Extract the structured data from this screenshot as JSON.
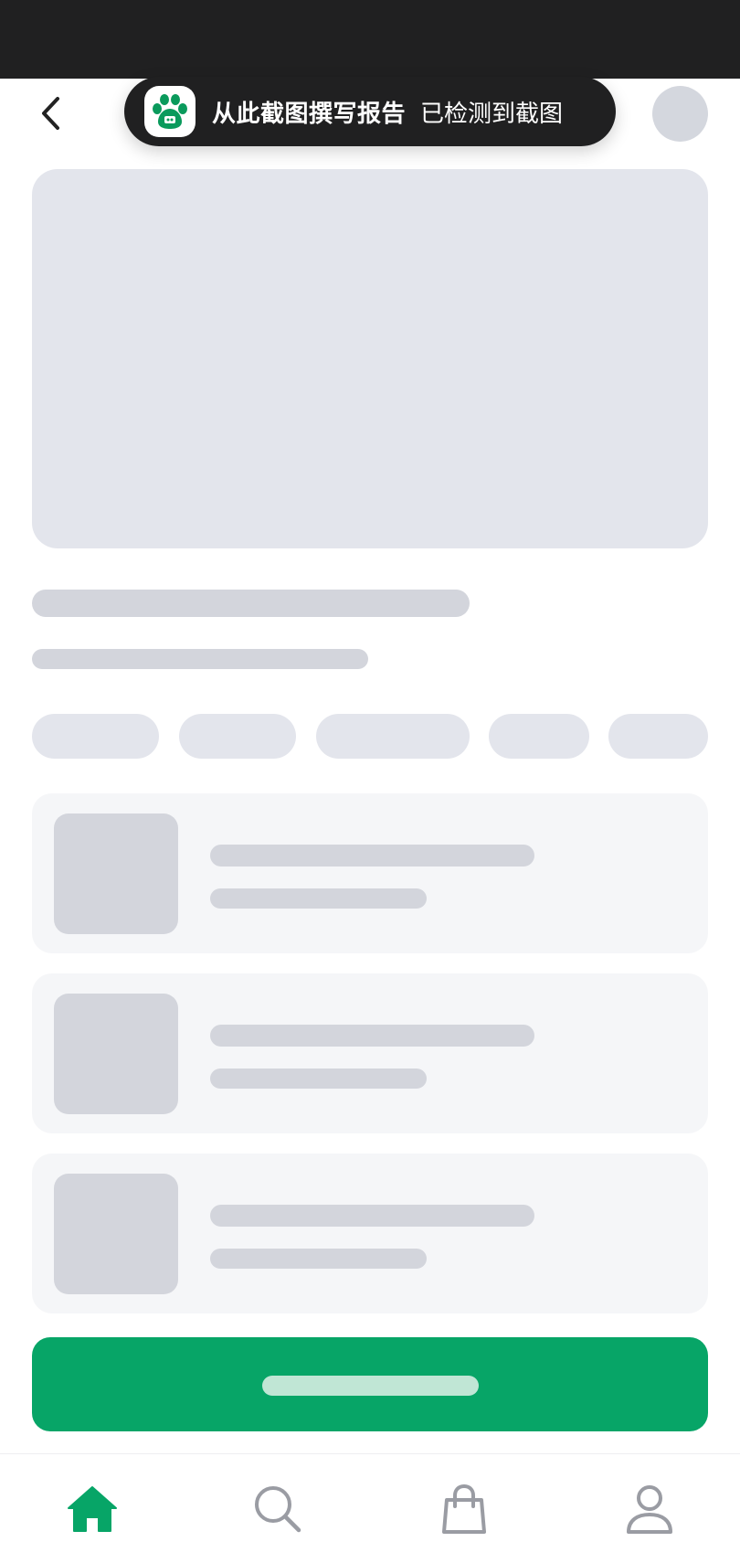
{
  "toast": {
    "title": "从此截图撰写报告",
    "subtitle": "已检测到截图",
    "icon": "paw-icon",
    "icon_color": "#0a9a5c"
  },
  "colors": {
    "accent": "#07a567",
    "skeleton": "#d3d5dc",
    "skeleton_light": "#e3e5ec",
    "card_bg": "#f5f6f8",
    "status_bar": "#202021",
    "tab_inactive": "#9a9ca3"
  },
  "header": {
    "back_icon": "chevron-left-icon"
  },
  "tabs": [
    {
      "name": "home",
      "icon": "home-icon",
      "active": true
    },
    {
      "name": "search",
      "icon": "search-icon",
      "active": false
    },
    {
      "name": "bag",
      "icon": "shopping-bag-icon",
      "active": false
    },
    {
      "name": "profile",
      "icon": "user-icon",
      "active": false
    }
  ]
}
